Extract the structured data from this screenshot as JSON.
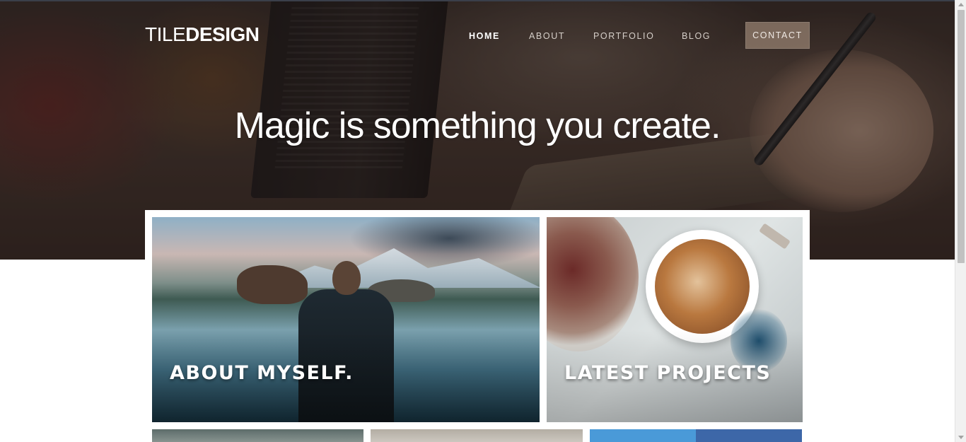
{
  "header": {
    "logo": {
      "light": "TILE",
      "bold": "DESIGN"
    },
    "nav": [
      {
        "label": "HOME",
        "active": true
      },
      {
        "label": "ABOUT",
        "active": false
      },
      {
        "label": "PORTFOLIO",
        "active": false
      },
      {
        "label": "BLOG",
        "active": false
      }
    ],
    "contact_label": "CONTACT"
  },
  "hero": {
    "headline": "Magic is something you create."
  },
  "tiles": [
    {
      "title": "ABOUT MYSELF."
    },
    {
      "title": "LATEST PROJECTS"
    }
  ],
  "colors": {
    "contact_bg": "#968070",
    "panel_bg": "#ffffff",
    "text_light": "#ffffff"
  }
}
